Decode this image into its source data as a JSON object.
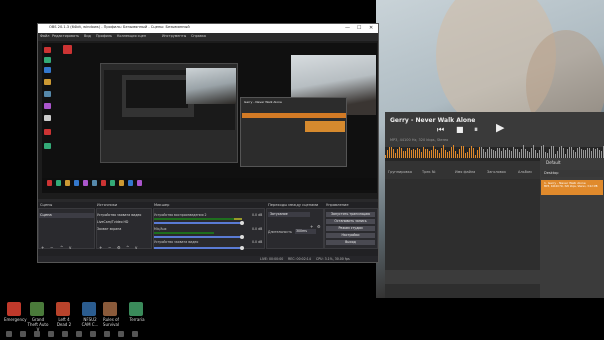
{
  "obs": {
    "title": "OBS 20.1.3 (64bit, windows) - Профиль: Безымянный - Сцены: Безымянный",
    "menu": [
      "Файл",
      "Редактировать",
      "Вид",
      "Профиль",
      "Коллекция сцен",
      "Инструменты",
      "Справка"
    ],
    "window_buttons": {
      "minimize": "—",
      "maximize": "☐",
      "close": "✕"
    },
    "docks": {
      "scenes_title": "Сцены",
      "sources_title": "Источники",
      "mixer_title": "Микшер",
      "transitions_title": "Переходы между сценами",
      "controls_title": "Управление"
    },
    "scenes": [
      "Сцена"
    ],
    "sources": [
      "Устройство захвата видео",
      "LiveCam/Tvideo HD",
      "Захват экрана"
    ],
    "mixer": [
      {
        "label": "Устройство воспроизведения 2",
        "db": "0.0 dB",
        "level": 0.82
      },
      {
        "label": "Mic/Aux",
        "db": "0.0 dB",
        "level": 0.6
      },
      {
        "label": "Устройство захвата видео",
        "db": "0.0 dB",
        "level": 0.0
      }
    ],
    "transitions": {
      "type": "Затухание",
      "duration_label": "Длительность",
      "duration": "300ms"
    },
    "controls": [
      "Запустить трансляцию",
      "Остановить запись",
      "Режим студии",
      "Настройки",
      "Выход"
    ],
    "status": {
      "live": "LIVE: 00:00:00",
      "rec": "REC: 00:02:14",
      "cpu": "CPU: 3.1%, 30.00 fps"
    }
  },
  "music_app": {
    "song": "Gerry - Never Walk Alone",
    "sub": "MP3, 44100 Hz, 320 kbps, Stereo",
    "controls": {
      "prev": "⏮",
      "stop": "■",
      "pause": "⏸",
      "play": "▶"
    },
    "tabs": [
      "Группировка",
      "Трек №",
      "Имя файла",
      "Заголовок",
      "Альбом"
    ],
    "playlist_title": "Default",
    "playlist_items": [
      "Desktop",
      "1. Gerry - Never Walk Alone"
    ],
    "playlist_item_sub": "MP3, 44100 Hz, 320 kbps, Stereo, 3:22 MB"
  },
  "taskbar": {
    "apps": [
      {
        "label": "Emergency",
        "color": "#c0392b"
      },
      {
        "label": "Grand Theft Auto V",
        "color": "#4a7a3a"
      },
      {
        "label": "Left 4 Dead 2",
        "color": "#b8432b"
      },
      {
        "label": "NFSU2 CAM C...",
        "color": "#2b5c8f"
      },
      {
        "label": "Rules of Survival",
        "color": "#8a5a3a"
      },
      {
        "label": "Terraria",
        "color": "#3a8a5a"
      }
    ]
  },
  "colors": {
    "accent": "#e08a2c",
    "meter": "#2ea12e",
    "slider": "#5a7bd6"
  }
}
